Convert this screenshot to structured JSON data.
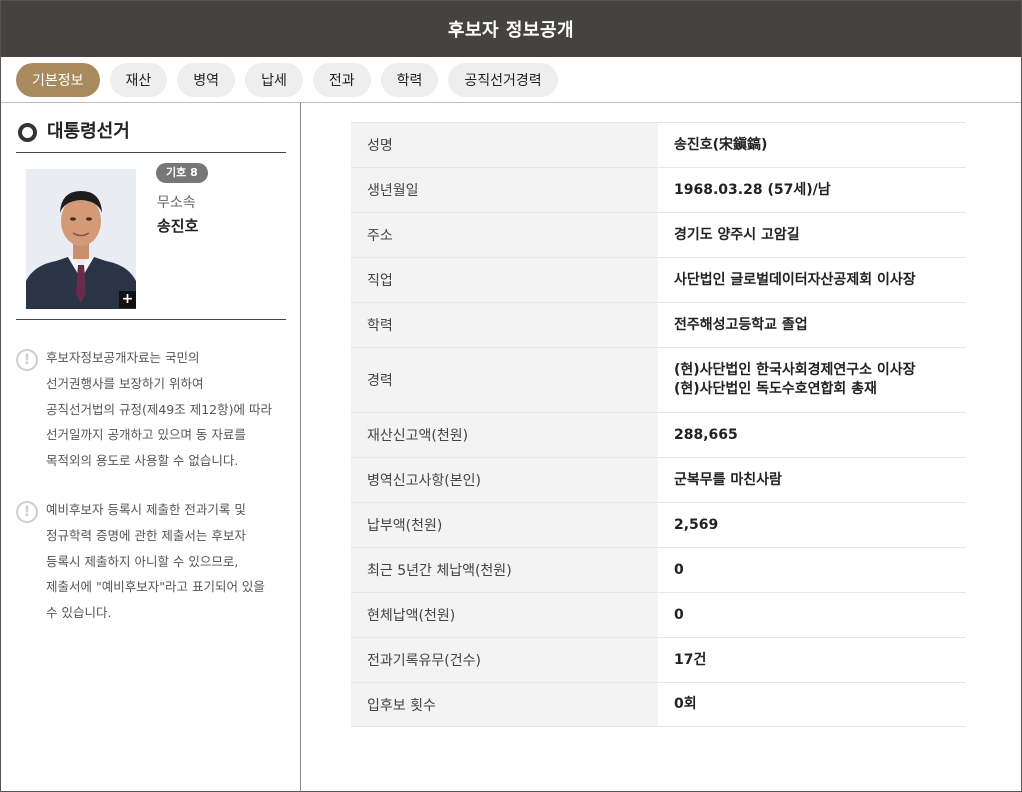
{
  "header": {
    "title": "후보자 정보공개"
  },
  "tabs": [
    {
      "label": "기본정보",
      "active": true
    },
    {
      "label": "재산"
    },
    {
      "label": "병역"
    },
    {
      "label": "납세"
    },
    {
      "label": "전과"
    },
    {
      "label": "학력"
    },
    {
      "label": "공직선거경력"
    }
  ],
  "sidebar": {
    "election_title": "대통령선거",
    "candidate": {
      "number_badge": "기호 8",
      "party": "무소속",
      "name": "송진호",
      "photo_icon": "candidate-photo",
      "expand_label": "+"
    },
    "notices": [
      {
        "icon": "exclamation-icon",
        "text_lines": [
          "후보자정보공개자료는 국민의",
          "선거권행사를 보장하기 위하여",
          "공직선거법의 규정(제49조 제12항)에 따라",
          "선거일까지 공개하고 있으며 동 자료를",
          "목적외의 용도로 사용할 수 없습니다."
        ]
      },
      {
        "icon": "exclamation-icon",
        "text_lines": [
          "예비후보자 등록시 제출한 전과기록 및",
          "정규학력 증명에 관한 제출서는 후보자",
          "등록시 제출하지 아니할 수 있으므로,",
          "제출서에 \"예비후보자\"라고 표기되어 있을",
          "수 있습니다."
        ]
      }
    ]
  },
  "info": {
    "rows": [
      {
        "label": "성명",
        "values": [
          "송진호(宋鎭鎬)"
        ]
      },
      {
        "label": "생년월일",
        "values": [
          "1968.03.28 (57세)/남"
        ]
      },
      {
        "label": "주소",
        "values": [
          "경기도 양주시 고암길"
        ]
      },
      {
        "label": "직업",
        "values": [
          "사단법인 글로벌데이터자산공제회 이사장"
        ]
      },
      {
        "label": "학력",
        "values": [
          "전주해성고등학교 졸업"
        ]
      },
      {
        "label": "경력",
        "values": [
          "(현)사단법인 한국사회경제연구소 이사장",
          "(현)사단법인 독도수호연합회 총재"
        ]
      },
      {
        "label": "재산신고액(천원)",
        "values": [
          "288,665"
        ]
      },
      {
        "label": "병역신고사항(본인)",
        "values": [
          "군복무를 마친사람"
        ]
      },
      {
        "label": "납부액(천원)",
        "values": [
          "2,569"
        ]
      },
      {
        "label": "최근 5년간 체납액(천원)",
        "values": [
          "0"
        ]
      },
      {
        "label": "현체납액(천원)",
        "values": [
          "0"
        ]
      },
      {
        "label": "전과기록유무(건수)",
        "values": [
          "17건"
        ]
      },
      {
        "label": "입후보 횟수",
        "values": [
          "0회"
        ]
      }
    ]
  }
}
